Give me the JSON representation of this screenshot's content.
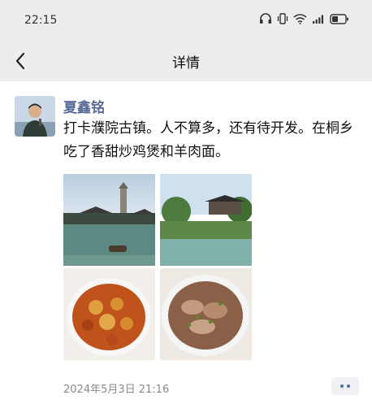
{
  "status_bar": {
    "time": "22:15",
    "icons": [
      "headset-icon",
      "vibrate-icon",
      "wifi-icon",
      "cellular-signal-icon",
      "battery-icon"
    ]
  },
  "nav": {
    "title": "详情",
    "back_icon": "chevron-left-icon"
  },
  "post": {
    "author": "夏鑫铭",
    "text": "打卡濮院古镇。人不算多，还有待开发。在桐乡吃了香甜炒鸡煲和羊肉面。",
    "photos": [
      {
        "subject": "canal-with-pagoda"
      },
      {
        "subject": "garden-pavilion-pond"
      },
      {
        "subject": "stir-fried-chicken-pot"
      },
      {
        "subject": "mutton-noodles"
      }
    ],
    "timestamp": "2024年5月3日 21:16"
  },
  "colors": {
    "header_bg": "#ededed",
    "author_link": "#576b95",
    "timestamp": "#8a8a8a",
    "more_button_bg": "#f0f1f5"
  }
}
